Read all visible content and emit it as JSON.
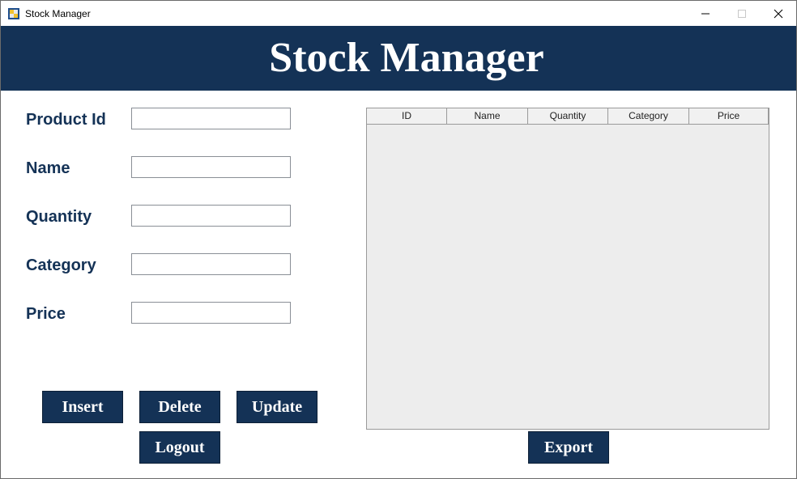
{
  "window": {
    "title": "Stock Manager",
    "icon": "app-window-icon",
    "controls": [
      "minimize-icon",
      "maximize-icon",
      "close-icon"
    ]
  },
  "banner": {
    "title": "Stock Manager",
    "color": "#143256"
  },
  "form": {
    "fields": [
      {
        "label": "Product Id",
        "value": ""
      },
      {
        "label": "Name",
        "value": ""
      },
      {
        "label": "Quantity",
        "value": ""
      },
      {
        "label": "Category",
        "value": ""
      },
      {
        "label": "Price",
        "value": ""
      }
    ]
  },
  "buttons": {
    "insert": "Insert",
    "delete": "Delete",
    "update": "Update",
    "logout": "Logout",
    "export": "Export"
  },
  "table": {
    "columns": [
      "ID",
      "Name",
      "Quantity",
      "Category",
      "Price"
    ],
    "rows": []
  },
  "colors": {
    "accent": "#143256",
    "table_bg": "#ededed"
  }
}
